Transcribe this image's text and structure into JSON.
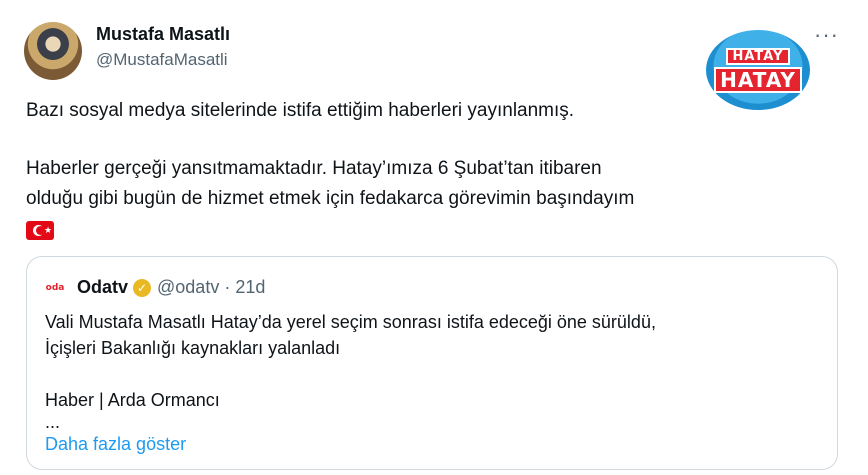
{
  "author": {
    "display_name": "Mustafa Masatlı",
    "handle": "@MustafaMasatli",
    "avatar_icon": "profile-photo"
  },
  "more_label": "···",
  "logo": {
    "text_top": "HATAY",
    "text_main": "HATAY",
    "colors": {
      "circle": "#3fb0e8",
      "box": "#e4242e"
    }
  },
  "tweet": {
    "line1": "Bazı sosyal medya sitelerinde istifa ettiğim haberleri yayınlanmış.",
    "line2": "Haberler gerçeği yansıtmamaktadır. Hatay’ımıza 6 Şubat’tan itibaren",
    "line3": "olduğu gibi bugün de hizmet etmek için fedakarca görevimin başındayım",
    "flag_icon": "turkey-flag"
  },
  "quote": {
    "avatar_text": "oda",
    "name": "Odatv",
    "verified_icon": "gold-verified-badge",
    "handle": "@odatv",
    "separator": "·",
    "time": "21d",
    "line1": "Vali Mustafa Masatlı Hatay’da yerel seçim sonrası istifa edeceği öne sürüldü,",
    "line2": "İçişleri Bakanlığı kaynakları yalanladı",
    "byline": "Haber | Arda Ormancı",
    "ellipsis": "...",
    "show_more": "Daha fazla göster"
  },
  "colors": {
    "link": "#1d9bf0",
    "muted": "#536471",
    "border": "#cfd9de",
    "flag_red": "#e30a17"
  }
}
